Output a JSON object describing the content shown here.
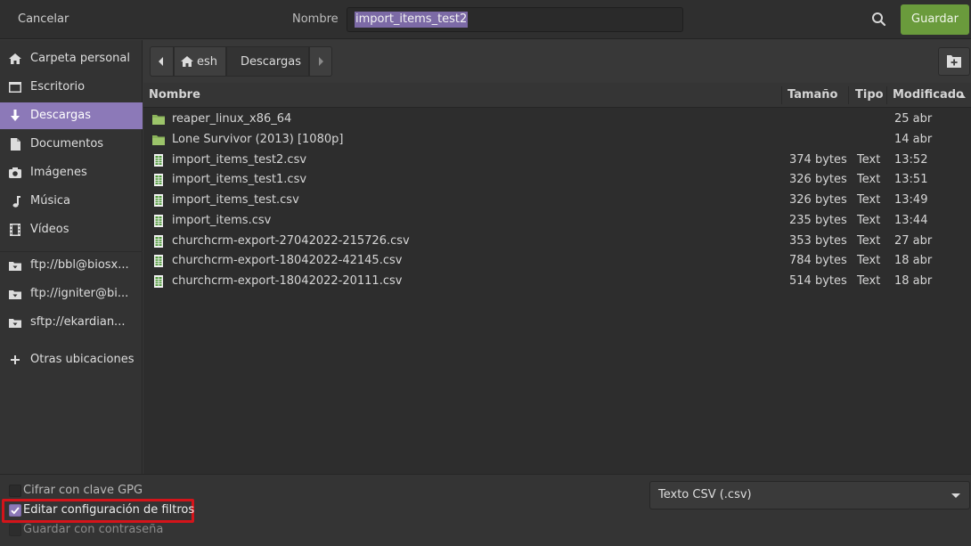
{
  "header": {
    "cancel_label": "Cancelar",
    "name_label": "Nombre",
    "name_value": "import_items_test2",
    "save_label": "Guardar"
  },
  "sidebar": {
    "items": [
      {
        "label": "Carpeta personal",
        "icon": "home-icon"
      },
      {
        "label": "Escritorio",
        "icon": "desktop-icon"
      },
      {
        "label": "Descargas",
        "icon": "download-icon",
        "active": true
      },
      {
        "label": "Documentos",
        "icon": "document-icon"
      },
      {
        "label": "Imágenes",
        "icon": "camera-icon"
      },
      {
        "label": "Música",
        "icon": "music-icon"
      },
      {
        "label": "Vídeos",
        "icon": "film-icon"
      }
    ],
    "remote": [
      {
        "label": "ftp://bbl@biosx...",
        "icon": "network-drive-icon"
      },
      {
        "label": "ftp://igniter@bi...",
        "icon": "network-drive-icon"
      },
      {
        "label": "sftp://ekardian...",
        "icon": "network-drive-icon"
      }
    ],
    "other_locations": "Otras ubicaciones"
  },
  "pathbar": {
    "segments": [
      "esh",
      "Descargas"
    ]
  },
  "columns": {
    "name": "Nombre",
    "size": "Tamaño",
    "type": "Tipo",
    "modified": "Modificado"
  },
  "files": [
    {
      "name": "reaper_linux_x86_64",
      "size": "",
      "type": "",
      "modified": "25 abr",
      "kind": "folder"
    },
    {
      "name": "Lone Survivor (2013) [1080p]",
      "size": "",
      "type": "",
      "modified": "14 abr",
      "kind": "folder"
    },
    {
      "name": "import_items_test2.csv",
      "size": "374 bytes",
      "type": "Text",
      "modified": "13:52",
      "kind": "csv"
    },
    {
      "name": "import_items_test1.csv",
      "size": "326 bytes",
      "type": "Text",
      "modified": "13:51",
      "kind": "csv"
    },
    {
      "name": "import_items_test.csv",
      "size": "326 bytes",
      "type": "Text",
      "modified": "13:49",
      "kind": "csv"
    },
    {
      "name": "import_items.csv",
      "size": "235 bytes",
      "type": "Text",
      "modified": "13:44",
      "kind": "csv"
    },
    {
      "name": "churchcrm-export-27042022-215726.csv",
      "size": "353 bytes",
      "type": "Text",
      "modified": "27 abr",
      "kind": "csv"
    },
    {
      "name": "churchcrm-export-18042022-42145.csv",
      "size": "784 bytes",
      "type": "Text",
      "modified": "18 abr",
      "kind": "csv"
    },
    {
      "name": "churchcrm-export-18042022-20111.csv",
      "size": "514 bytes",
      "type": "Text",
      "modified": "18 abr",
      "kind": "csv"
    }
  ],
  "options": {
    "gpg_label": "Cifrar con clave GPG",
    "gpg_checked": false,
    "filters_label": "Editar configuración de filtros",
    "filters_checked": true,
    "password_label": "Guardar con contraseña",
    "password_checked": false
  },
  "filter": {
    "selected": "Texto CSV (.csv)"
  },
  "colors": {
    "accent": "#8c79b8",
    "save": "#6a9b3c",
    "highlight": "#d4141a",
    "folder": "#8ab35a"
  }
}
